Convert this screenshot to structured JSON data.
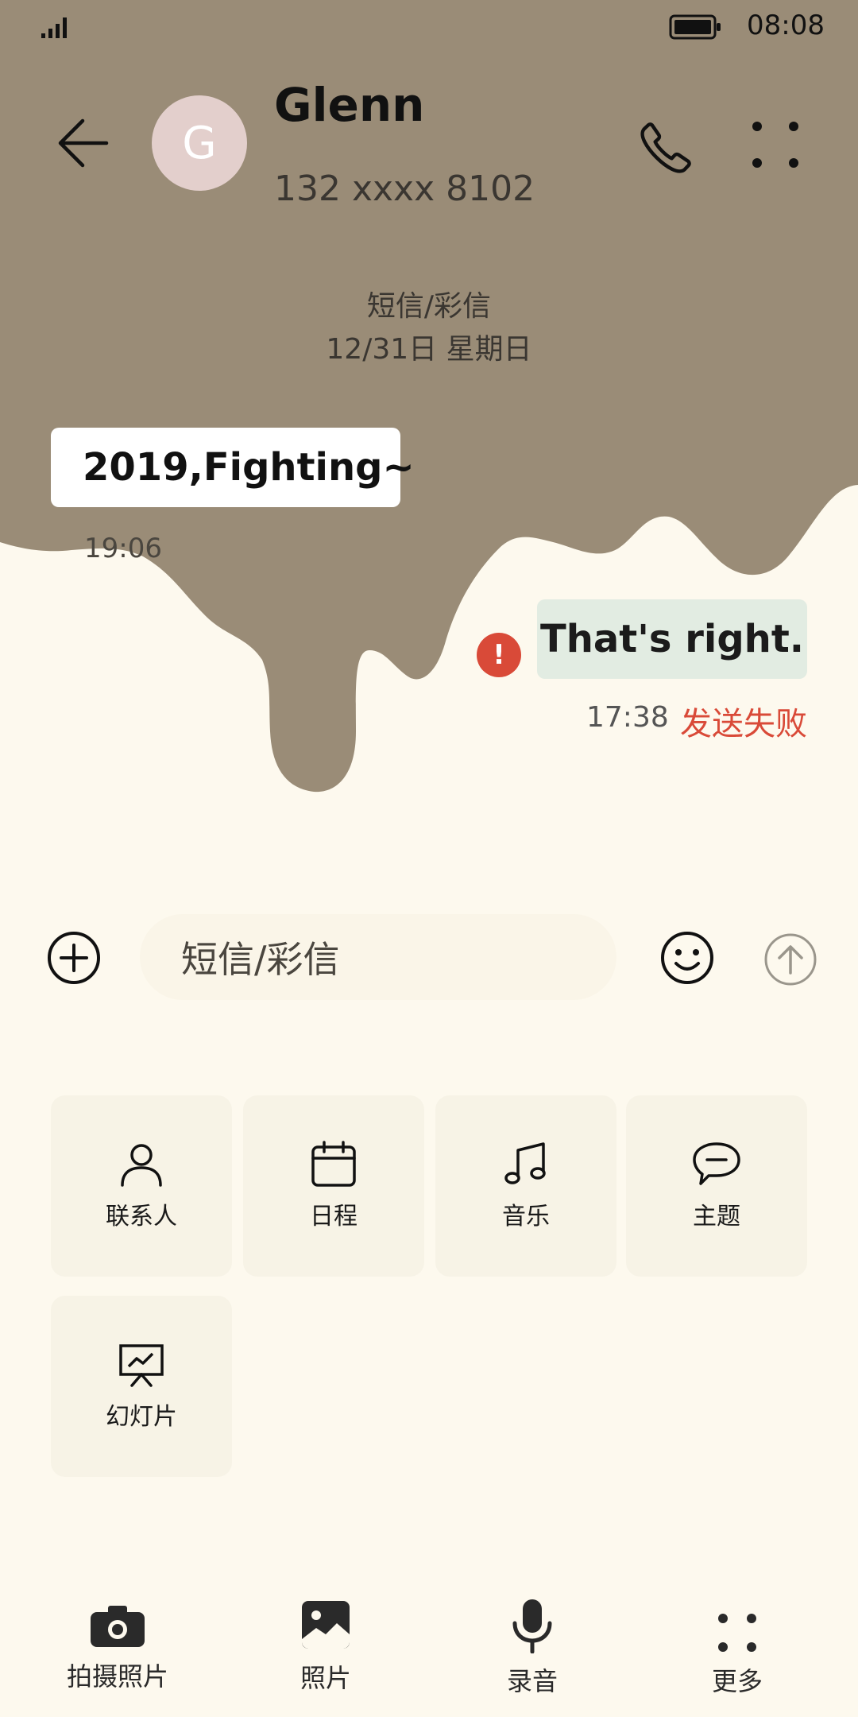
{
  "status_bar": {
    "time": "08:08"
  },
  "header": {
    "avatar_letter": "G",
    "name": "Glenn",
    "number": "132 xxxx 8102"
  },
  "thread": {
    "channel": "短信/彩信",
    "date": "12/31日 星期日",
    "messages": [
      {
        "direction": "incoming",
        "text": "2019,Fighting~",
        "time": "19:06"
      },
      {
        "direction": "outgoing",
        "text": "That's right.",
        "time": "17:38",
        "status": "发送失败",
        "error_badge": "!"
      }
    ]
  },
  "composer": {
    "placeholder": "短信/彩信"
  },
  "attachments": [
    {
      "label": "联系人",
      "icon": "person-icon"
    },
    {
      "label": "日程",
      "icon": "calendar-icon"
    },
    {
      "label": "音乐",
      "icon": "music-note-icon"
    },
    {
      "label": "主题",
      "icon": "speech-bubble-icon"
    },
    {
      "label": "幻灯片",
      "icon": "presentation-icon"
    }
  ],
  "bottom_bar": [
    {
      "label": "拍摄照片",
      "icon": "camera-icon"
    },
    {
      "label": "照片",
      "icon": "photo-icon"
    },
    {
      "label": "录音",
      "icon": "microphone-icon"
    },
    {
      "label": "更多",
      "icon": "more-dots-icon"
    }
  ],
  "colors": {
    "theme_brown": "#9a8c77",
    "background_cream": "#fdf9ee",
    "error_red": "#d94a38",
    "outgoing_bubble": "#e2ece2"
  }
}
